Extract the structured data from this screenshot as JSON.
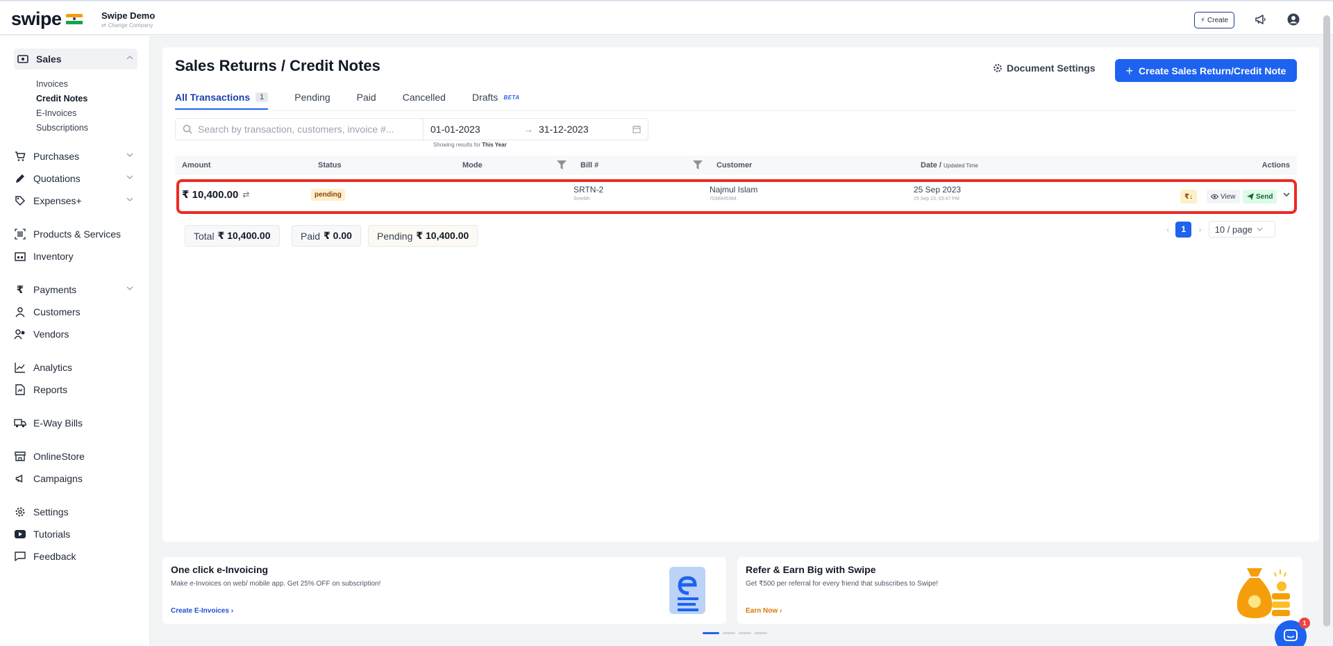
{
  "app": {
    "logo_text": "swipe",
    "company_name": "Swipe Demo",
    "change_company": "Change Company",
    "create_label": "Create"
  },
  "sidebar": {
    "sales": {
      "label": "Sales",
      "sub_items": [
        "Invoices",
        "Credit Notes",
        "E-Invoices",
        "Subscriptions"
      ],
      "active_sub": "Credit Notes"
    },
    "items": [
      {
        "label": "Purchases",
        "icon": "cart-icon",
        "has_chevron": true
      },
      {
        "label": "Quotations",
        "icon": "pen-icon",
        "has_chevron": true
      },
      {
        "label": "Expenses+",
        "icon": "tag-icon",
        "has_chevron": true
      },
      {
        "label": "Products & Services",
        "icon": "barcode-icon",
        "has_chevron": false
      },
      {
        "label": "Inventory",
        "icon": "warehouse-icon",
        "has_chevron": false
      },
      {
        "label": "Payments",
        "icon": "rupee-icon",
        "has_chevron": true
      },
      {
        "label": "Customers",
        "icon": "user-icon",
        "has_chevron": false
      },
      {
        "label": "Vendors",
        "icon": "users-icon",
        "has_chevron": false
      },
      {
        "label": "Analytics",
        "icon": "chart-line-icon",
        "has_chevron": false
      },
      {
        "label": "Reports",
        "icon": "file-report-icon",
        "has_chevron": false
      },
      {
        "label": "E-Way Bills",
        "icon": "truck-icon",
        "has_chevron": false
      },
      {
        "label": "OnlineStore",
        "icon": "store-icon",
        "has_chevron": false
      },
      {
        "label": "Campaigns",
        "icon": "megaphone-icon",
        "has_chevron": false
      },
      {
        "label": "Settings",
        "icon": "gear-icon",
        "has_chevron": false
      },
      {
        "label": "Tutorials",
        "icon": "youtube-icon",
        "has_chevron": false
      },
      {
        "label": "Feedback",
        "icon": "message-icon",
        "has_chevron": false
      }
    ]
  },
  "page": {
    "title": "Sales Returns / Credit Notes",
    "document_settings": "Document Settings",
    "create_button": "Create Sales Return/Credit Note"
  },
  "tabs": [
    {
      "label": "All Transactions",
      "count": "1",
      "active": true
    },
    {
      "label": "Pending"
    },
    {
      "label": "Paid"
    },
    {
      "label": "Cancelled"
    },
    {
      "label": "Drafts",
      "badge": "BETA"
    }
  ],
  "filters": {
    "search_placeholder": "Search by transaction, customers, invoice #...",
    "date_from": "01-01-2023",
    "date_to": "31-12-2023",
    "showing_prefix": "Showing results for",
    "showing_period": "This Year"
  },
  "table": {
    "headers": {
      "amount": "Amount",
      "status": "Status",
      "mode": "Mode",
      "bill": "Bill #",
      "customer": "Customer",
      "date": "Date /",
      "date_sub": "Updated Time",
      "actions": "Actions"
    },
    "rows": [
      {
        "amount": "₹ 10,400.00",
        "status": "pending",
        "mode": "",
        "bill": "SRTN-2",
        "bill_sub": "Sreelith",
        "customer": "Najmul Islam",
        "customer_phone": "7036845384",
        "date": "25 Sep 2023",
        "updated": "25 Sep 23, 03:47 PM",
        "actions": {
          "rupee": "₹↓",
          "view": "View",
          "send": "Send"
        }
      }
    ]
  },
  "summary": {
    "total_label": "Total",
    "total_value": "₹ 10,400.00",
    "paid_label": "Paid",
    "paid_value": "₹ 0.00",
    "pending_label": "Pending",
    "pending_value": "₹ 10,400.00"
  },
  "pagination": {
    "current_page": "1",
    "per_page": "10 / page"
  },
  "promos": [
    {
      "title": "One click e-Invoicing",
      "text": "Make e-Invoices on web/ mobile app. Get 25% OFF on subscription!",
      "link": "Create E-Invoices",
      "link_color": "#1e4fd8"
    },
    {
      "title": "Refer & Earn Big with Swipe",
      "text": "Get ₹500 per referral for every friend that subscribes to Swipe!",
      "link": "Earn Now",
      "link_color": "#d97706"
    }
  ],
  "chat": {
    "badge": "1"
  },
  "colors": {
    "primary": "#1e63f0",
    "highlight_outline": "#ee2a24",
    "pending_badge_bg": "#fdf0c8"
  }
}
